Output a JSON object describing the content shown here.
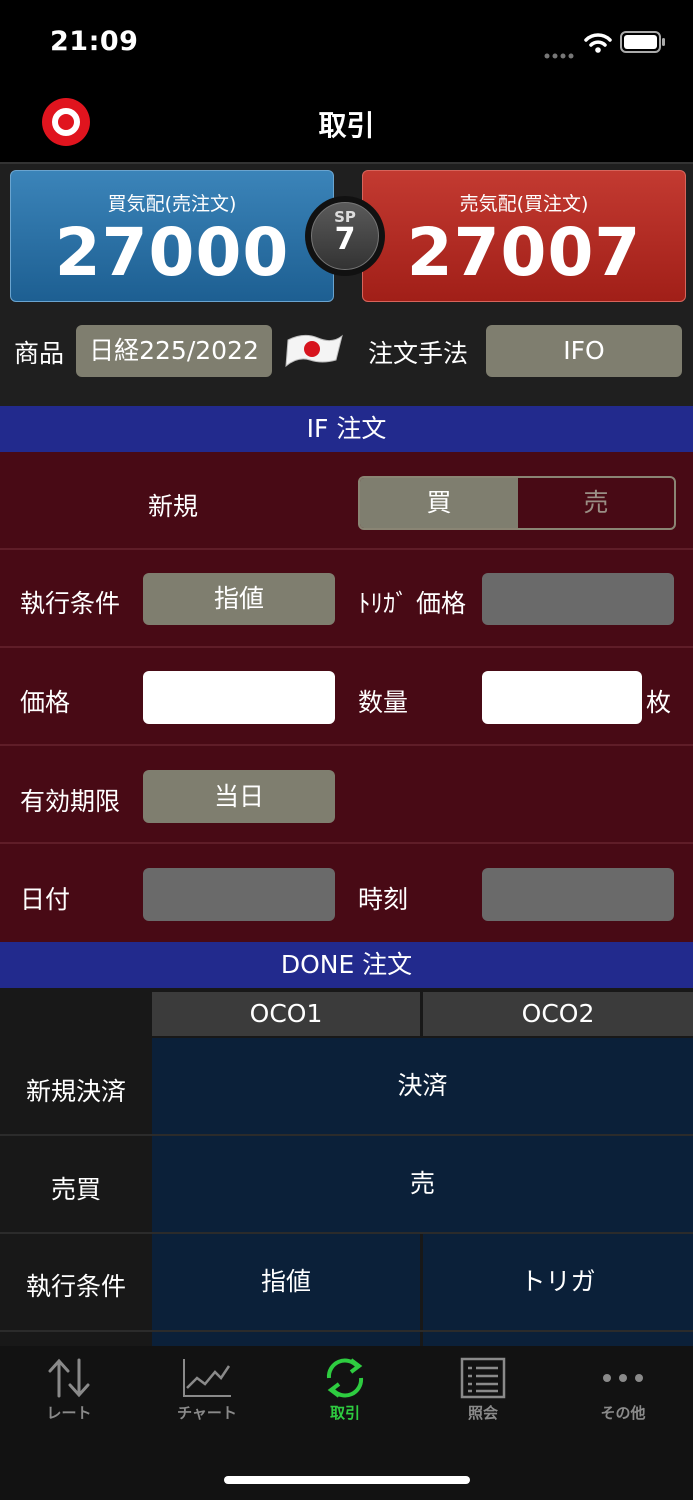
{
  "status_bar": {
    "time": "21:09"
  },
  "header": {
    "title": "取引"
  },
  "quotes": {
    "bid_label": "買気配(売注文)",
    "bid_value": "27000",
    "ask_label": "売気配(買注文)",
    "ask_value": "27007",
    "spread_label": "SP",
    "spread_value": "7"
  },
  "product": {
    "label": "商品",
    "value": "日経225/2022",
    "method_label": "注文手法",
    "method_value": "IFO"
  },
  "if_section": {
    "header": "IF 注文",
    "new_label": "新規",
    "buy_label": "買",
    "sell_label": "売",
    "exec_label": "執行条件",
    "exec_value": "指値",
    "trigger_label": "ﾄﾘｶﾞ 価格",
    "price_label": "価格",
    "quantity_label": "数量",
    "quantity_unit": "枚",
    "validity_label": "有効期限",
    "validity_value": "当日",
    "date_label": "日付",
    "time_label": "時刻"
  },
  "done_section": {
    "header": "DONE 注文",
    "col1": "OCO1",
    "col2": "OCO2",
    "row1_label": "新規決済",
    "row1_value": "決済",
    "row2_label": "売買",
    "row2_value": "売",
    "row3_label": "執行条件",
    "row3_col1": "指値",
    "row3_col2": "トリガ"
  },
  "tabs": [
    {
      "label": "レート",
      "icon": "arrows-updown-icon"
    },
    {
      "label": "チャート",
      "icon": "line-chart-icon"
    },
    {
      "label": "取引",
      "icon": "refresh-icon",
      "active": true
    },
    {
      "label": "照会",
      "icon": "list-icon"
    },
    {
      "label": "その他",
      "icon": "more-icon"
    }
  ],
  "colors": {
    "active_tab": "#2ecc40",
    "bid": "#2a6fa5",
    "ask": "#b52a22",
    "section_header": "#222a8d"
  }
}
